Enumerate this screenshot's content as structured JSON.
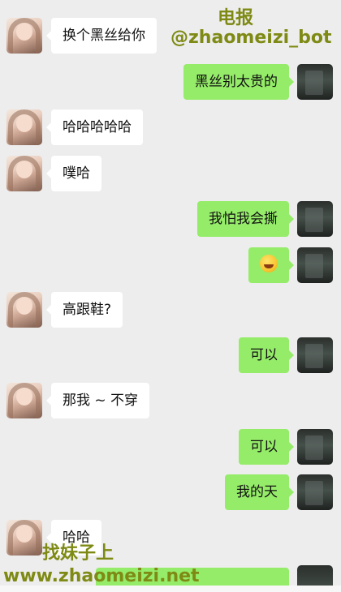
{
  "watermarks": {
    "telegram_label": "电报",
    "telegram_handle": "@zhaomeizi_bot",
    "site_title": "找妹子上",
    "site_url": "www.zhaomeizi.net"
  },
  "messages": [
    {
      "from": "other",
      "text": "换个黑丝给你"
    },
    {
      "from": "self",
      "text": "黑丝别太贵的"
    },
    {
      "from": "other",
      "text": "哈哈哈哈哈"
    },
    {
      "from": "other",
      "text": "噗哈"
    },
    {
      "from": "self",
      "text": "我怕我会撕"
    },
    {
      "from": "self",
      "text": "",
      "emoji": "laughing-crying-emoji"
    },
    {
      "from": "other",
      "text": "高跟鞋?"
    },
    {
      "from": "self",
      "text": "可以"
    },
    {
      "from": "other",
      "text": "那我 ~ 不穿"
    },
    {
      "from": "self",
      "text": "可以"
    },
    {
      "from": "self",
      "text": "我的天"
    },
    {
      "from": "other",
      "text": "哈哈"
    }
  ],
  "colors": {
    "background": "#ededed",
    "self_bubble": "#95ec69",
    "other_bubble": "#ffffff",
    "watermark": "#7e8a14"
  }
}
